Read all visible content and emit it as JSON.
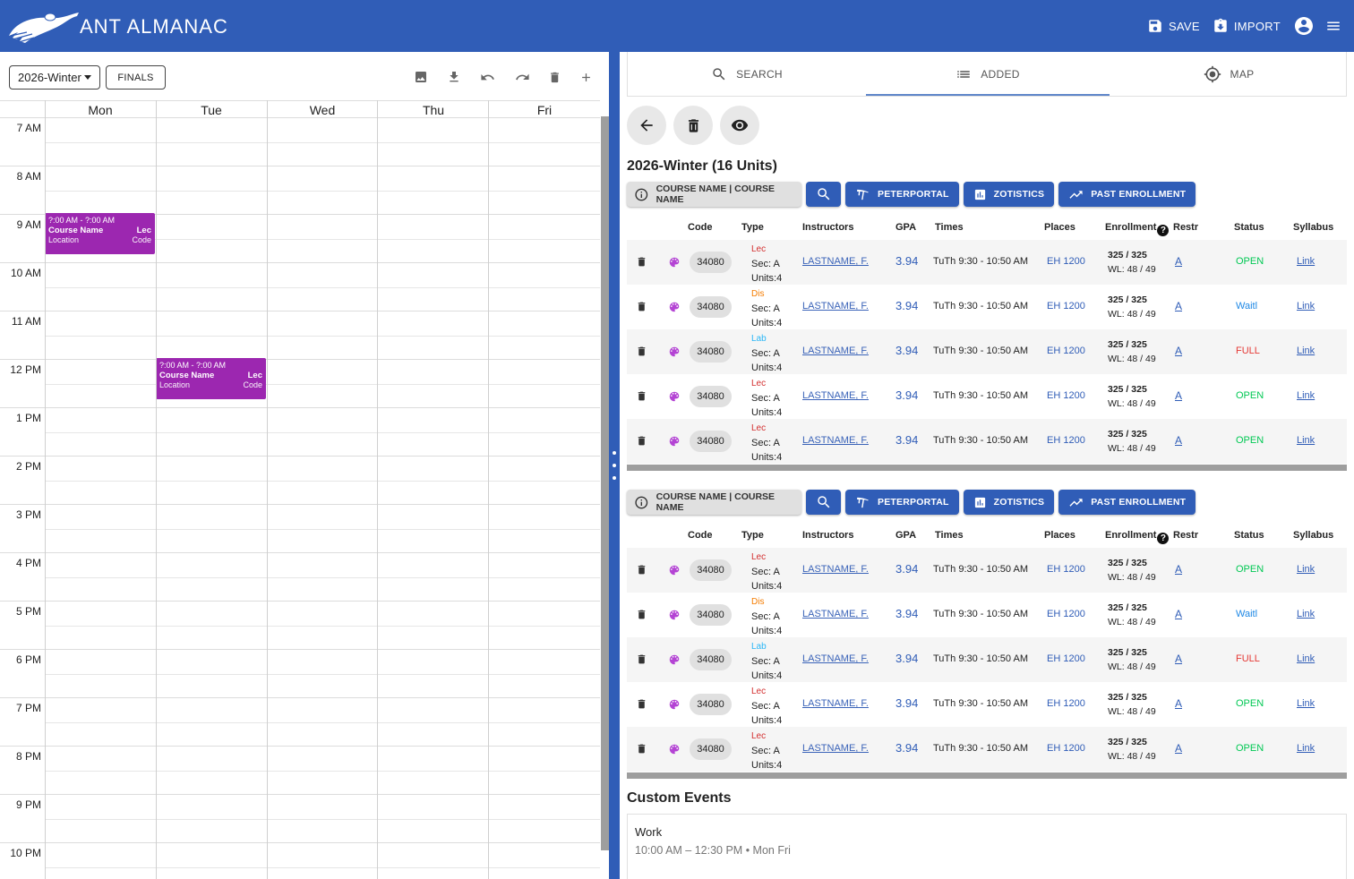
{
  "header": {
    "title": "ANT ALMANAC",
    "save_label": "SAVE",
    "import_label": "IMPORT",
    "brand_color": "#305db7"
  },
  "calendar": {
    "term": "2026-Winter",
    "finals_label": "FINALS",
    "days": [
      "Mon",
      "Tue",
      "Wed",
      "Thu",
      "Fri"
    ],
    "hours": [
      "7 AM",
      "8 AM",
      "9 AM",
      "10 AM",
      "11 AM",
      "12 PM",
      "1 PM",
      "2 PM",
      "3 PM",
      "4 PM",
      "5 PM",
      "6 PM",
      "7 PM",
      "8 PM",
      "9 PM",
      "10 PM"
    ],
    "events": [
      {
        "time": "?:00 AM - ?:00 AM",
        "name": "Course Name",
        "type": "Lec",
        "location": "Location",
        "code": "Code",
        "color": "#9c27b0"
      },
      {
        "time": "?:00 AM - ?:00 AM",
        "name": "Course Name",
        "type": "Lec",
        "location": "Location",
        "code": "Code",
        "color": "#9c27b0"
      }
    ]
  },
  "tabs": {
    "search": "SEARCH",
    "added": "ADDED",
    "map": "MAP"
  },
  "schedule": {
    "title": "2026-Winter (16 Units)",
    "columns": [
      "Code",
      "Type",
      "Instructors",
      "GPA",
      "Times",
      "Places",
      "Enrollment",
      "Restr",
      "Status",
      "Syllabus"
    ],
    "blocks": [
      {
        "course_label": "COURSE NAME | COURSE NAME",
        "peterportal_label": "PETERPORTAL",
        "zotistics_label": "ZOTISTICS",
        "past_enrollment_label": "PAST ENROLLMENT",
        "rows": [
          {
            "code": "34080",
            "type": "Lec",
            "type_color": "#d32f2f",
            "sec": "Sec: A",
            "units": "Units:4",
            "instructor": "LASTNAME, F.",
            "gpa": "3.94",
            "times": "TuTh 9:30 - 10:50 AM",
            "place": "EH 1200",
            "enrolled": "325 / 325",
            "waitlist": "WL: 48 / 49",
            "restr": "A",
            "status": "OPEN",
            "status_color": "#00c853",
            "syllabus": "Link"
          },
          {
            "code": "34080",
            "type": "Dis",
            "type_color": "#f57c00",
            "sec": "Sec: A",
            "units": "Units:4",
            "instructor": "LASTNAME, F.",
            "gpa": "3.94",
            "times": "TuTh 9:30 - 10:50 AM",
            "place": "EH 1200",
            "enrolled": "325 / 325",
            "waitlist": "WL: 48 / 49",
            "restr": "A",
            "status": "Waitl",
            "status_color": "#1e88e5",
            "syllabus": "Link"
          },
          {
            "code": "34080",
            "type": "Lab",
            "type_color": "#29b6f6",
            "sec": "Sec: A",
            "units": "Units:4",
            "instructor": "LASTNAME, F.",
            "gpa": "3.94",
            "times": "TuTh 9:30 - 10:50 AM",
            "place": "EH 1200",
            "enrolled": "325 / 325",
            "waitlist": "WL: 48 / 49",
            "restr": "A",
            "status": "FULL",
            "status_color": "#e53935",
            "syllabus": "Link"
          },
          {
            "code": "34080",
            "type": "Lec",
            "type_color": "#d32f2f",
            "sec": "Sec: A",
            "units": "Units:4",
            "instructor": "LASTNAME, F.",
            "gpa": "3.94",
            "times": "TuTh 9:30 - 10:50 AM",
            "place": "EH 1200",
            "enrolled": "325 / 325",
            "waitlist": "WL: 48 / 49",
            "restr": "A",
            "status": "OPEN",
            "status_color": "#00c853",
            "syllabus": "Link"
          },
          {
            "code": "34080",
            "type": "Lec",
            "type_color": "#d32f2f",
            "sec": "Sec: A",
            "units": "Units:4",
            "instructor": "LASTNAME, F.",
            "gpa": "3.94",
            "times": "TuTh 9:30 - 10:50 AM",
            "place": "EH 1200",
            "enrolled": "325 / 325",
            "waitlist": "WL: 48 / 49",
            "restr": "A",
            "status": "OPEN",
            "status_color": "#00c853",
            "syllabus": "Link"
          }
        ]
      },
      {
        "course_label": "COURSE NAME | COURSE NAME",
        "peterportal_label": "PETERPORTAL",
        "zotistics_label": "ZOTISTICS",
        "past_enrollment_label": "PAST ENROLLMENT",
        "rows": [
          {
            "code": "34080",
            "type": "Lec",
            "type_color": "#d32f2f",
            "sec": "Sec: A",
            "units": "Units:4",
            "instructor": "LASTNAME, F.",
            "gpa": "3.94",
            "times": "TuTh 9:30 - 10:50 AM",
            "place": "EH 1200",
            "enrolled": "325 / 325",
            "waitlist": "WL: 48 / 49",
            "restr": "A",
            "status": "OPEN",
            "status_color": "#00c853",
            "syllabus": "Link"
          },
          {
            "code": "34080",
            "type": "Dis",
            "type_color": "#f57c00",
            "sec": "Sec: A",
            "units": "Units:4",
            "instructor": "LASTNAME, F.",
            "gpa": "3.94",
            "times": "TuTh 9:30 - 10:50 AM",
            "place": "EH 1200",
            "enrolled": "325 / 325",
            "waitlist": "WL: 48 / 49",
            "restr": "A",
            "status": "Waitl",
            "status_color": "#1e88e5",
            "syllabus": "Link"
          },
          {
            "code": "34080",
            "type": "Lab",
            "type_color": "#29b6f6",
            "sec": "Sec: A",
            "units": "Units:4",
            "instructor": "LASTNAME, F.",
            "gpa": "3.94",
            "times": "TuTh 9:30 - 10:50 AM",
            "place": "EH 1200",
            "enrolled": "325 / 325",
            "waitlist": "WL: 48 / 49",
            "restr": "A",
            "status": "FULL",
            "status_color": "#e53935",
            "syllabus": "Link"
          },
          {
            "code": "34080",
            "type": "Lec",
            "type_color": "#d32f2f",
            "sec": "Sec: A",
            "units": "Units:4",
            "instructor": "LASTNAME, F.",
            "gpa": "3.94",
            "times": "TuTh 9:30 - 10:50 AM",
            "place": "EH 1200",
            "enrolled": "325 / 325",
            "waitlist": "WL: 48 / 49",
            "restr": "A",
            "status": "OPEN",
            "status_color": "#00c853",
            "syllabus": "Link"
          },
          {
            "code": "34080",
            "type": "Lec",
            "type_color": "#d32f2f",
            "sec": "Sec: A",
            "units": "Units:4",
            "instructor": "LASTNAME, F.",
            "gpa": "3.94",
            "times": "TuTh 9:30 - 10:50 AM",
            "place": "EH 1200",
            "enrolled": "325 / 325",
            "waitlist": "WL: 48 / 49",
            "restr": "A",
            "status": "OPEN",
            "status_color": "#00c853",
            "syllabus": "Link"
          }
        ]
      }
    ]
  },
  "custom_events": {
    "title": "Custom Events",
    "items": [
      {
        "name": "Work",
        "detail": "10:00 AM – 12:30 PM • Mon Fri"
      }
    ]
  }
}
